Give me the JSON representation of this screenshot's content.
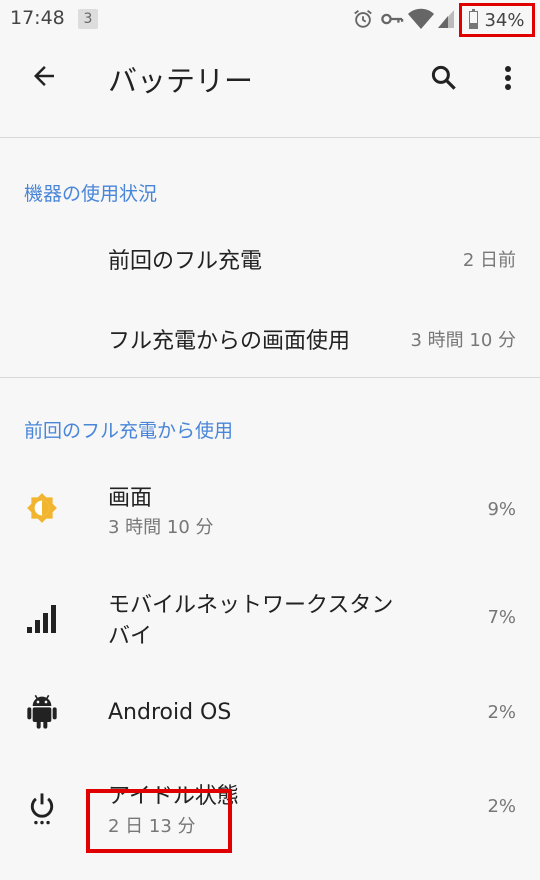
{
  "status_bar": {
    "time": "17:48",
    "notification_count": "3",
    "battery_percent": "34%",
    "battery_level": 0.34,
    "icons": [
      "alarm-icon",
      "vpn-key-icon",
      "wifi-icon",
      "signal-icon",
      "battery-icon"
    ]
  },
  "toolbar": {
    "title": "バッテリー",
    "back_icon": "arrow-back-icon",
    "search_icon": "search-icon",
    "more_icon": "more-vert-icon"
  },
  "device_usage": {
    "header": "機器の使用状況",
    "items": [
      {
        "label": "前回のフル充電",
        "value": "2 日前"
      },
      {
        "label": "フル充電からの画面使用",
        "value": "3 時間 10 分"
      }
    ]
  },
  "usage_since_charge": {
    "header": "前回のフル充電から使用",
    "items": [
      {
        "icon": "brightness-icon",
        "label": "画面",
        "sub": "3 時間 10 分",
        "value": "9%"
      },
      {
        "icon": "cell-signal-icon",
        "label": "モバイルネットワークスタン\nバイ",
        "label_line1": "モバイルネットワークスタン",
        "label_line2": "バイ",
        "value": "7%"
      },
      {
        "icon": "android-icon",
        "label": "Android OS",
        "value": "2%"
      },
      {
        "icon": "power-idle-icon",
        "label": "アイドル状態",
        "sub": "2 日 13 分",
        "value": "2%"
      }
    ]
  },
  "colors": {
    "accent": "#4a86d8",
    "highlight": "#e00000",
    "brightness_icon": "#f2b530",
    "background": "#f7f7f7"
  }
}
